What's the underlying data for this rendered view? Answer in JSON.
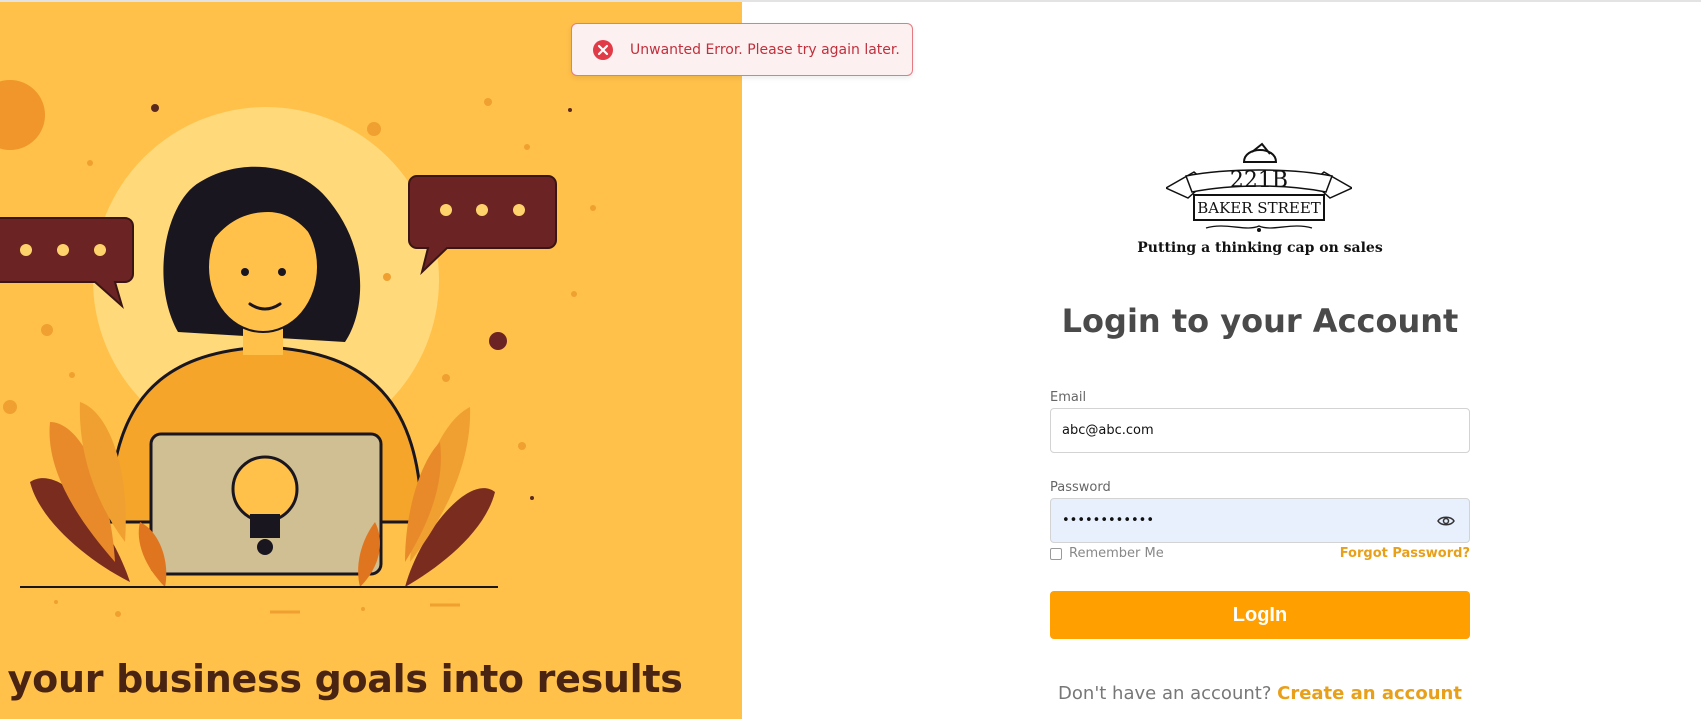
{
  "toast": {
    "icon": "error-circle-icon",
    "message": "Unwanted Error. Please try again later."
  },
  "hero": {
    "tagline": "n your business goals into results",
    "illustration": "woman-with-laptop-lightbulb-illustration"
  },
  "brand": {
    "logo_line1": "221B",
    "logo_line2": "BAKER STREET",
    "subtitle": "Putting a thinking cap on sales"
  },
  "form": {
    "title": "Login to your Account",
    "email_label": "Email",
    "email_value": "abc@abc.com",
    "password_label": "Password",
    "password_value": "••••••••••••",
    "remember_label": "Remember Me",
    "forgot_label": "Forgot Password?",
    "login_label": "LogIn",
    "signup_prompt": "Don't have an account?",
    "signup_link": "Create an account"
  },
  "colors": {
    "accent": "#ff9f00",
    "hero_bg": "#ffc149",
    "error": "#c0303c"
  }
}
